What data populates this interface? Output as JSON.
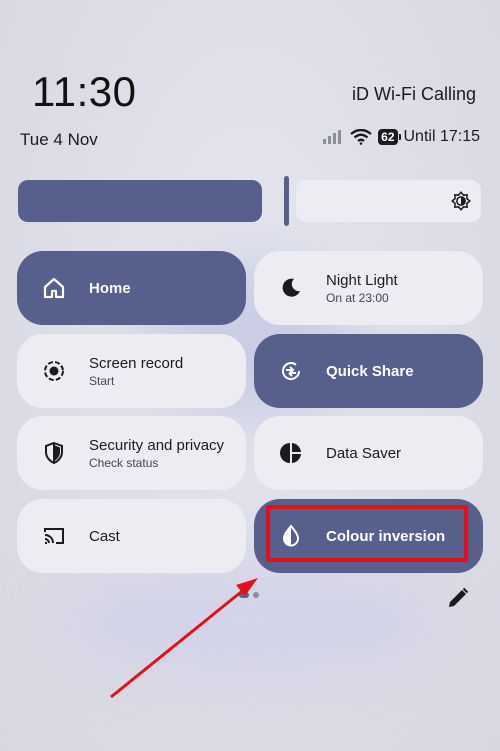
{
  "status_bar": {
    "time": "11:30",
    "carrier": "iD Wi-Fi Calling",
    "date": "Tue 4 Nov",
    "battery": "62",
    "alarm": "Until 17:15"
  },
  "brightness": {
    "level": 0.52,
    "icon": "brightness-icon"
  },
  "tiles": {
    "home": {
      "label": "Home",
      "icon": "home-icon",
      "active": true
    },
    "night_light": {
      "label": "Night Light",
      "sub": "On at 23:00",
      "icon": "moon-icon",
      "active": false
    },
    "screen_record": {
      "label": "Screen record",
      "sub": "Start",
      "icon": "screen-record-icon",
      "active": false
    },
    "quick_share": {
      "label": "Quick Share",
      "icon": "quick-share-icon",
      "active": true
    },
    "security": {
      "label": "Security and privacy",
      "sub": "Check status",
      "icon": "shield-icon",
      "active": false
    },
    "data_saver": {
      "label": "Data Saver",
      "icon": "data-saver-icon",
      "active": false
    },
    "cast": {
      "label": "Cast",
      "icon": "cast-icon",
      "active": false
    },
    "colour_inversion": {
      "label": "Colour inversion",
      "icon": "colour-inversion-icon",
      "active": true
    }
  },
  "pager": {
    "pages": 2,
    "current": 1
  },
  "colors": {
    "accent": "#575f8d",
    "tile_off": "#ececf2",
    "annotation": "#e3101c"
  }
}
